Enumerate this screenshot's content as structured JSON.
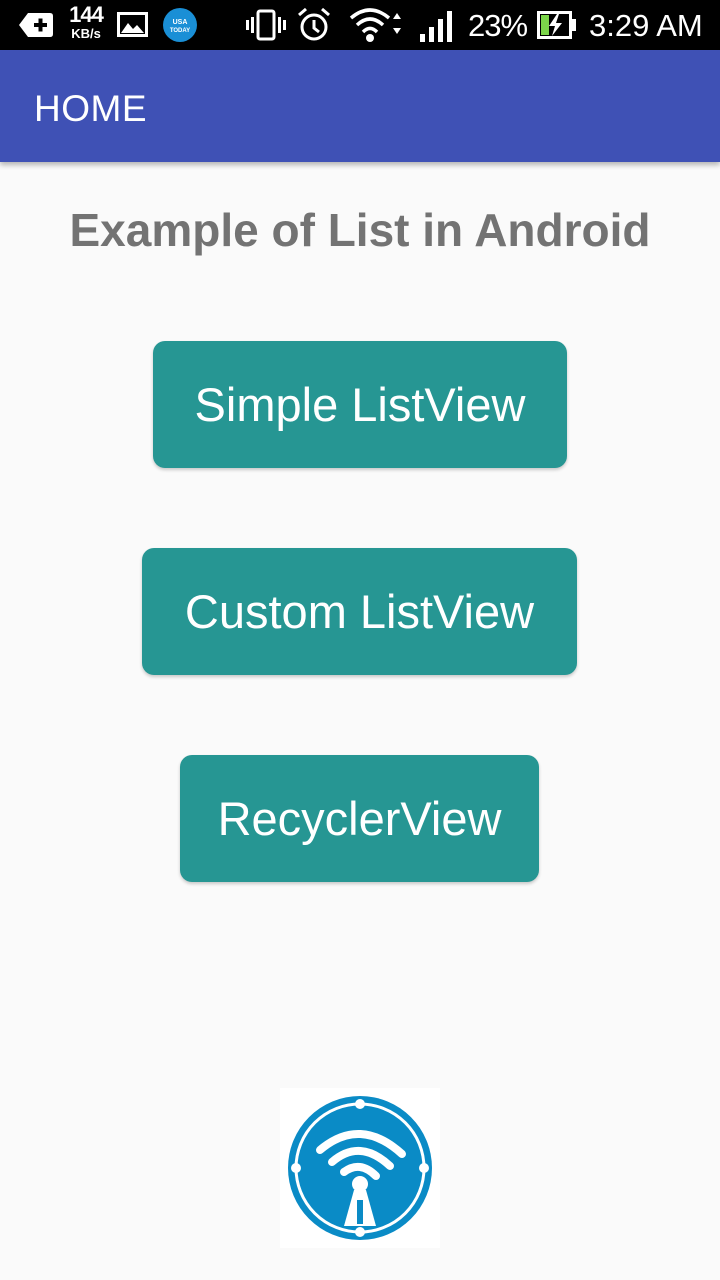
{
  "status_bar": {
    "net_speed_value": "144",
    "net_speed_unit": "KB/s",
    "battery_percent": "23%",
    "time": "3:29 AM",
    "icons": [
      "plus-notification-icon",
      "image-icon",
      "usa-today-icon",
      "vibrate-icon",
      "alarm-icon",
      "wifi-icon",
      "signal-icon",
      "battery-charging-icon"
    ],
    "usa_today_label_1": "USA",
    "usa_today_label_2": "TODAY"
  },
  "app_bar": {
    "title": "HOME",
    "color": "#3f51b5"
  },
  "main": {
    "heading": "Example of List in Android",
    "buttons": [
      {
        "label": "Simple ListView"
      },
      {
        "label": "Custom ListView"
      },
      {
        "label": "RecyclerView"
      }
    ],
    "button_color": "#269693",
    "logo": "wifi-antenna-logo"
  }
}
